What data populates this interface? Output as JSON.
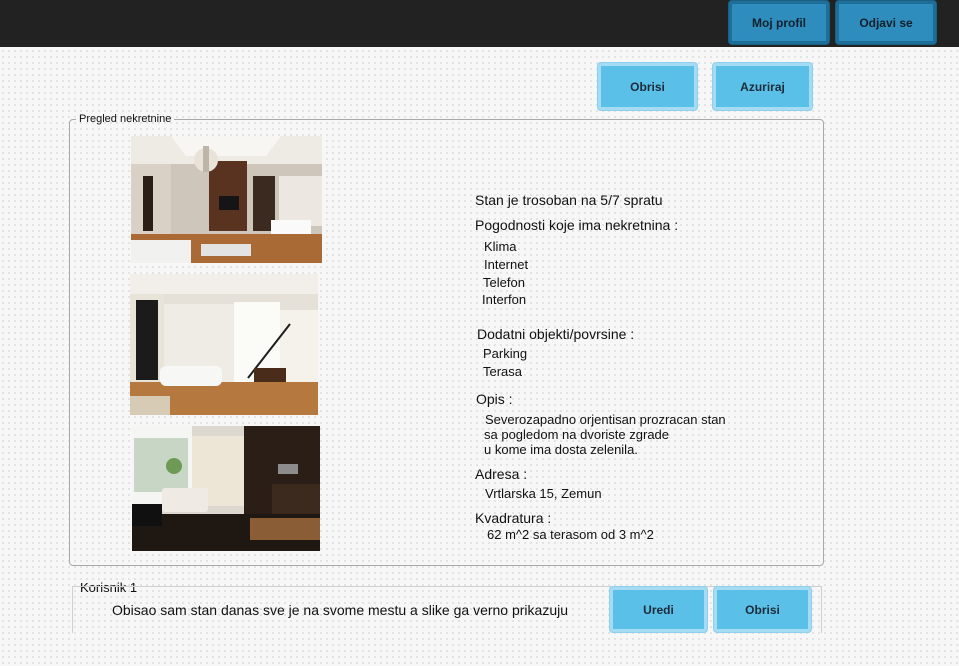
{
  "header": {
    "profile_label": "Moj profil",
    "logout_label": "Odjavi se"
  },
  "actions": {
    "delete_label": "Obrisi",
    "update_label": "Azuriraj"
  },
  "property": {
    "legend": "Pregled nekretnine",
    "summary": "Stan je trosoban na 5/7 spratu",
    "amenities_heading": "Pogodnosti koje ima nekretnina :",
    "amenities": [
      "Klima",
      "Internet",
      "Telefon",
      "Interfon"
    ],
    "extras_heading": "Dodatni objekti/povrsine :",
    "extras": [
      "Parking",
      "Terasa"
    ],
    "description_heading": "Opis :",
    "description_lines": [
      "Severozapadno orjentisan prozracan stan",
      "sa pogledom na dvoriste zgrade",
      "u kome ima dosta zelenila."
    ],
    "address_heading": "Adresa :",
    "address": "Vrtlarska 15, Zemun",
    "area_heading": "Kvadratura :",
    "area": "62 m^2 sa terasom od 3 m^2"
  },
  "comment": {
    "author": "Korisnik 1",
    "text": "Obisao sam stan danas sve je na svome mestu a slike ga verno prikazuju",
    "edit_label": "Uredi",
    "delete_label": "Obrisi"
  },
  "colors": {
    "topbar": "#222222",
    "button": "#5bc0e8",
    "button_dark": "#2e8dbd"
  }
}
